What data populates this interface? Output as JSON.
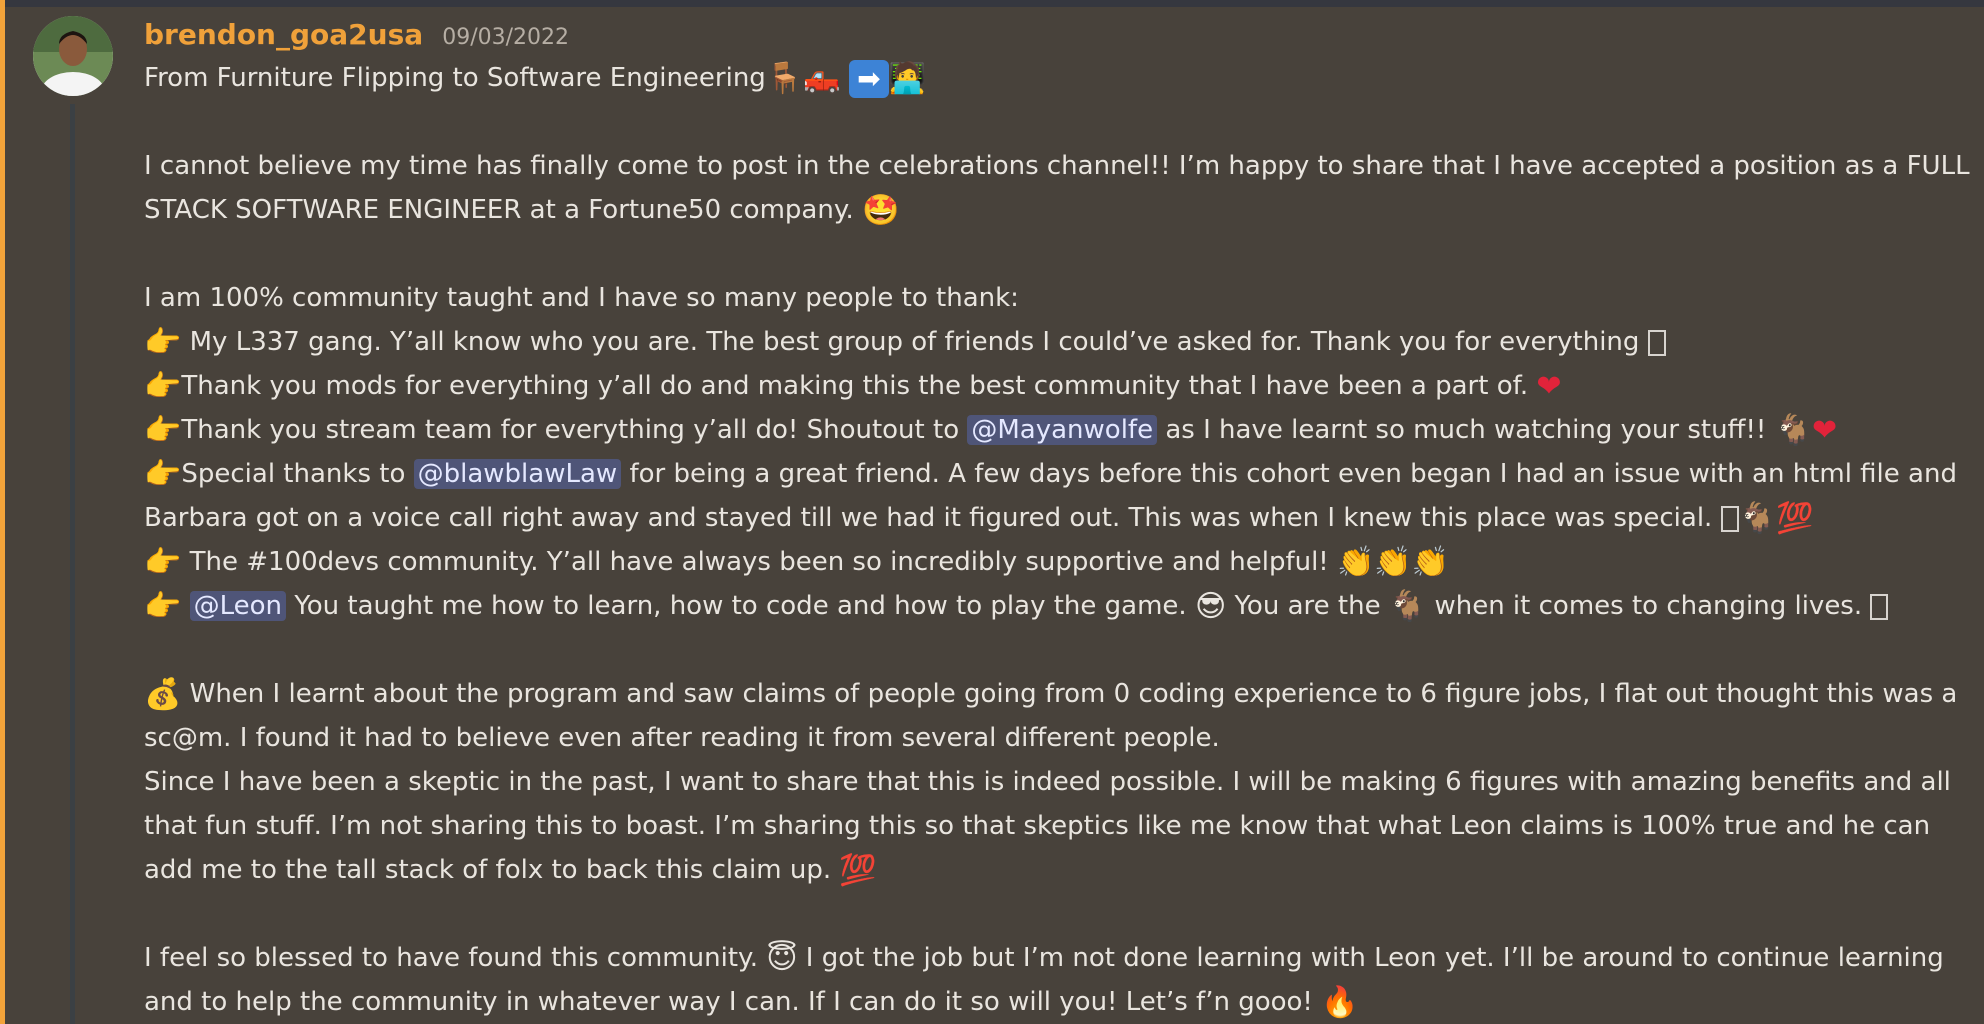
{
  "message": {
    "username": "brendon_goa2usa",
    "timestamp": "09/03/2022",
    "lines": {
      "title": "From Furniture Flipping to Software Engineering",
      "p1": "I cannot believe my time has finally come to post in the celebrations channel!! I’m happy to share that I have accepted a position as a FULL STACK SOFTWARE ENGINEER at a Fortune50 company.",
      "p2": "I am 100% community taught and I have so many people to thank:",
      "b1": " My L337 gang. Y’all know who you are. The best group of friends I could’ve asked for. Thank you for everything",
      "b2": "Thank you mods for everything y’all do and making this the best community that I have been a part of.",
      "b3a": "Thank you stream team for everything y’all do! Shoutout to",
      "b3m": "@Mayanwolfe",
      "b3b": "as I have learnt so much watching your stuff!!",
      "b4a": "Special thanks to",
      "b4m": "@blawblawLaw",
      "b4b": "for being a great friend. A few days before this cohort even began I had an issue with an html file and Barbara got on a voice call right away and stayed till we had it figured out. This was when I knew this place was special.",
      "b5": " The #100devs community. Y’all have always been so incredibly supportive and helpful!",
      "b6m": "@Leon",
      "b6a": "You taught me how to learn, how to code and how to play the game.",
      "b6b": "You are the",
      "b6c": "when it comes to changing lives.",
      "p3": "When I learnt about the program and saw claims of people going from 0 coding experience to 6 figure jobs, I flat out thought this was a sc@m. I found it had to believe even after reading it from several different people.",
      "p4": "Since I have been a skeptic in the past, I want to share that this is indeed possible. I will be making 6 figures with amazing benefits and all that fun stuff. I’m not sharing this to boast. I’m sharing this so that skeptics like me know that what Leon claims is 100% true and he can add me to the tall stack of folx to back this claim up.",
      "p5a": "I feel so blessed to have found this community.",
      "p5b": "I got the job but I’m not done learning with Leon yet. I’ll be around to continue learning and to help the community in whatever way I can. If I can do it so will you! Let’s f’n gooo!"
    }
  },
  "colors": {
    "background": "#48423b",
    "username": "#f0a13a",
    "mention_bg": "#4f5578",
    "accent_bar": "#f2a33a"
  },
  "icons": [
    "chair-emoji",
    "pickup-truck-emoji",
    "right-arrow-emoji",
    "technologist-emoji",
    "star-struck-emoji",
    "backhand-index-right-emoji",
    "red-heart-emoji",
    "goat-emoji",
    "hundred-points-emoji",
    "clapping-hands-emoji",
    "sunglasses-emoji",
    "money-bag-emoji",
    "smiling-halo-emoji",
    "fire-emoji"
  ]
}
